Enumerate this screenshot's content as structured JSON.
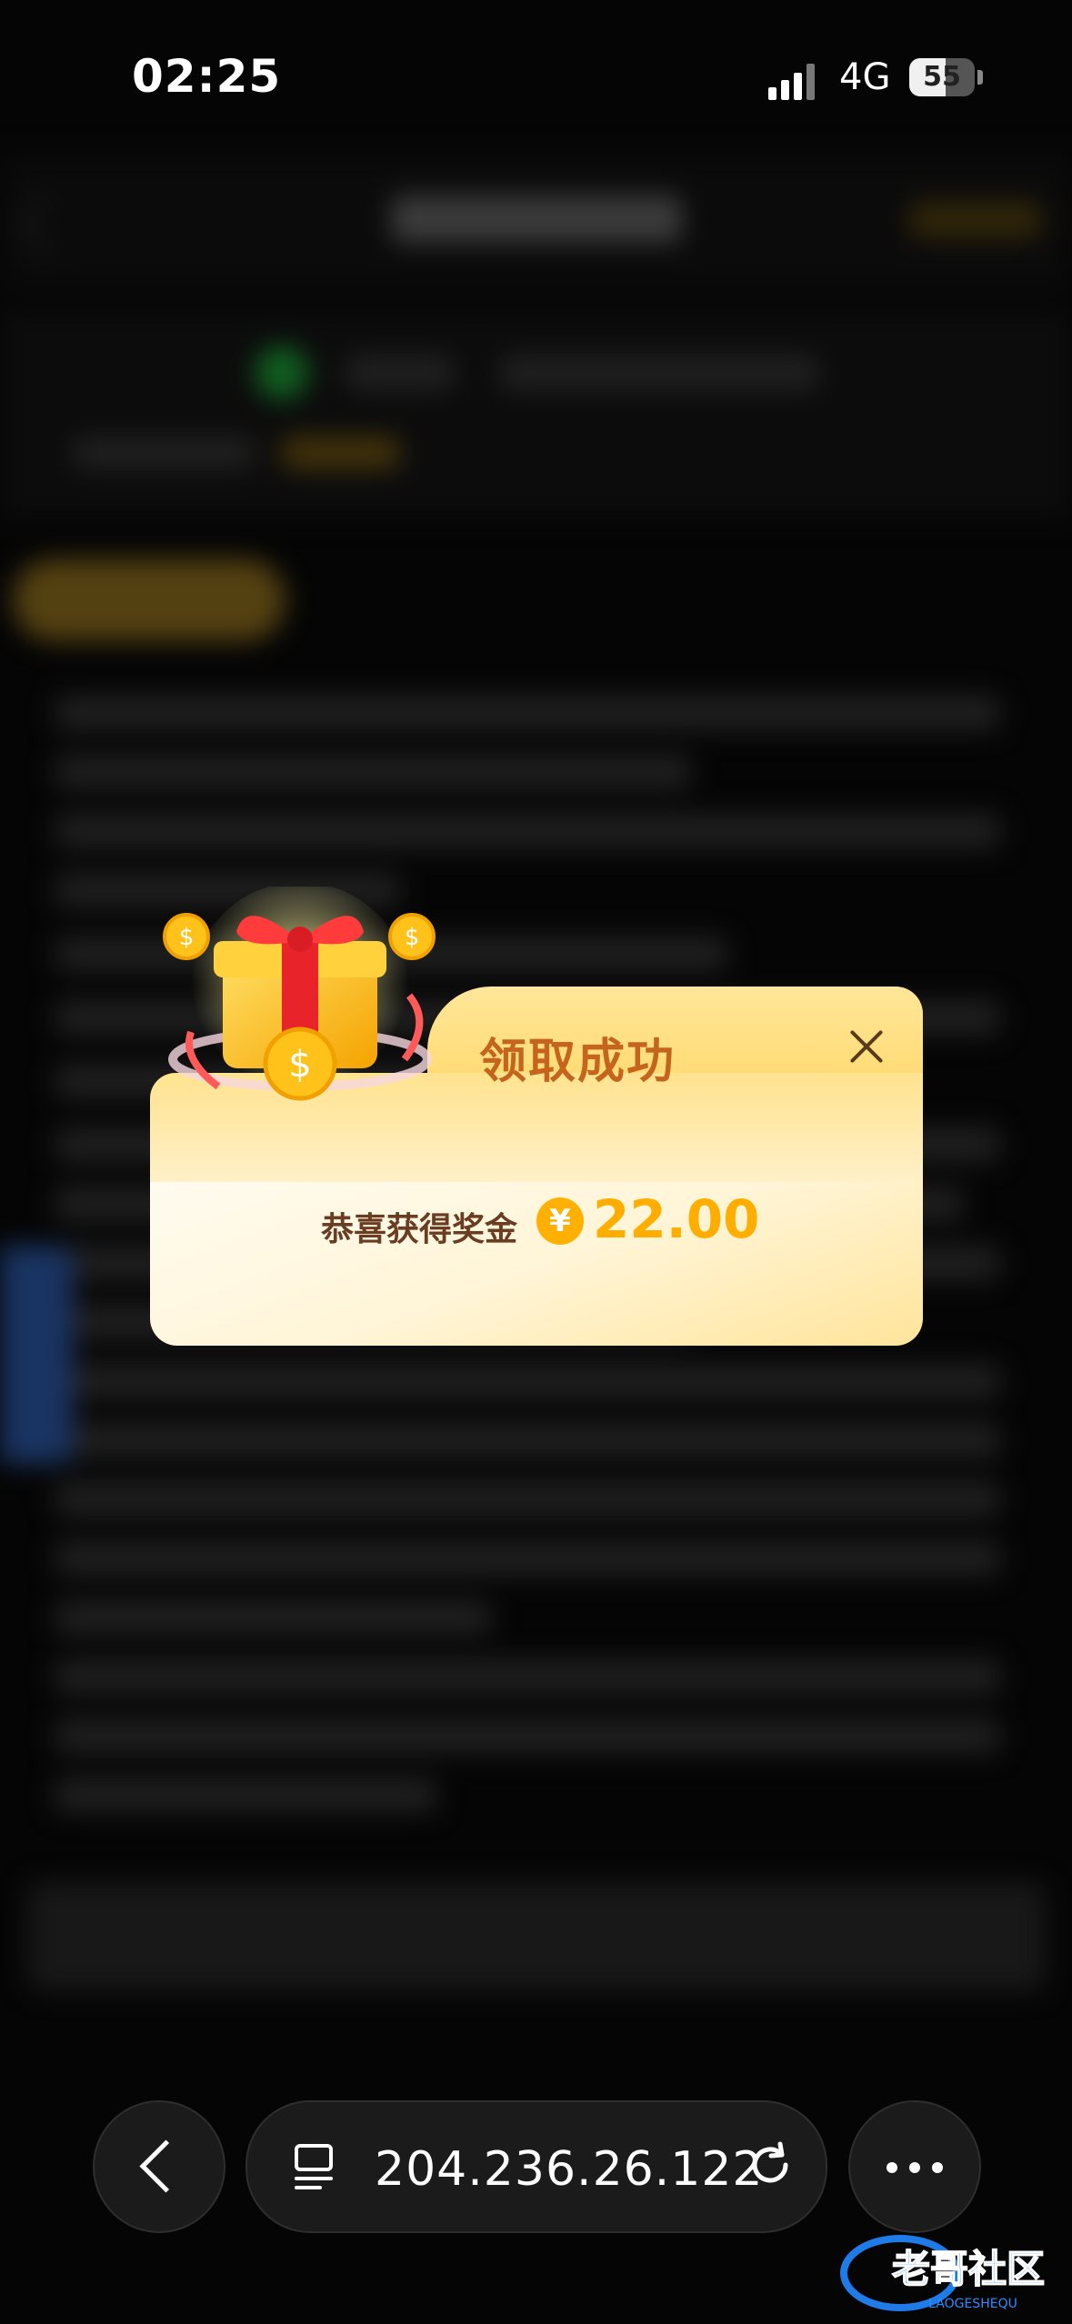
{
  "status_bar": {
    "time": "02:25",
    "network": "4G",
    "battery": "55"
  },
  "popup": {
    "title": "领取成功",
    "reward_label": "恭喜获得奖金",
    "currency_symbol": "¥",
    "amount": "22.00"
  },
  "browser_bar": {
    "url": "204.236.26.122"
  },
  "watermark": {
    "text": "老哥社区",
    "subtext": "LAOGESHEQU"
  },
  "colors": {
    "popup_title": "#c5641d",
    "amount": "#ffae00",
    "reward_label": "#6a3d22",
    "background": "#0a0a0a"
  }
}
